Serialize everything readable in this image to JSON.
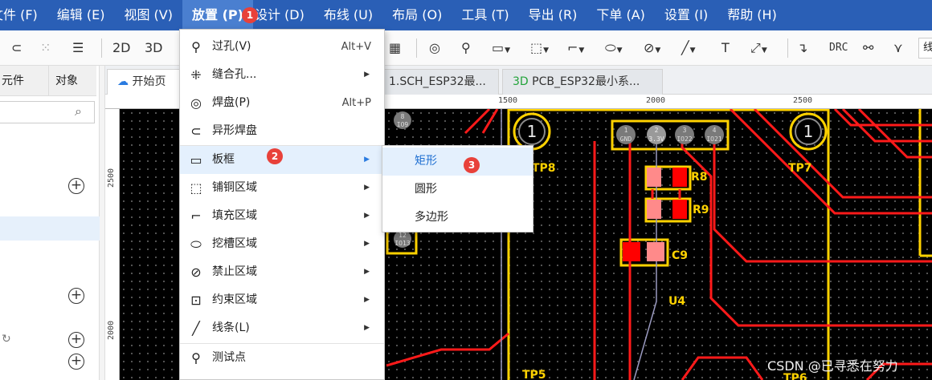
{
  "colors": {
    "menubar": "#2a5fb6",
    "menubar_active": "#4a7fd0",
    "badge": "#e8413a",
    "menu_hover": "#e4f0fd",
    "pcb_background": "#000000",
    "track_red": "#ff1a1a",
    "silkscreen_yellow": "#ffd200",
    "pad_pink": "#ff8a8a",
    "pad_red": "#ff0000"
  },
  "menubar": {
    "items": [
      "文件 (F)",
      "编辑 (E)",
      "视图 (V)",
      "放置 (P)",
      "设计 (D)",
      "布线 (U)",
      "布局 (O)",
      "工具 (T)",
      "导出 (R)",
      "下单 (A)",
      "设置 (I)",
      "帮助 (H)"
    ],
    "active_index": 3
  },
  "badges": {
    "b1": "1",
    "b2": "2",
    "b3": "3"
  },
  "toolbar": {
    "view_2d": "2D",
    "view_3d": "3D",
    "drc": "DRC",
    "search_text": "线",
    "icons": [
      "undo-icon",
      "select-grid-icon",
      "list-search-icon",
      "grid-icon",
      "via-icon",
      "stitch-icon",
      "board-frame-icon",
      "copper-area-icon",
      "fill-area-icon",
      "slot-icon",
      "keepout-icon",
      "line-icon",
      "text-icon",
      "dimension-icon",
      "route-icon",
      "diff-pair-icon",
      "length-tune-icon"
    ]
  },
  "left_panel": {
    "tab_components": "元件",
    "tab_objects": "对象"
  },
  "doc_tabs": {
    "home": "开始页",
    "sch": "1.SCH_ESP32最...",
    "pcb_prefix": "3D",
    "pcb": "PCB_ESP32最小系..."
  },
  "ruler": {
    "h": [
      "1500",
      "2000",
      "2500"
    ],
    "v": [
      "2500",
      "2000"
    ]
  },
  "place_menu": {
    "items": [
      {
        "label": "过孔(V)",
        "shortcut": "Alt+V",
        "submenu": false,
        "icon": "via-icon"
      },
      {
        "label": "缝合孔...",
        "shortcut": "",
        "submenu": true,
        "icon": "stitching-via-icon"
      },
      {
        "label": "焊盘(P)",
        "shortcut": "Alt+P",
        "submenu": false,
        "icon": "pad-icon"
      },
      {
        "label": "异形焊盘",
        "shortcut": "",
        "submenu": false,
        "icon": "custom-pad-icon"
      },
      {
        "label": "板框",
        "shortcut": "",
        "submenu": true,
        "icon": "board-frame-icon"
      },
      {
        "label": "铺铜区域",
        "shortcut": "",
        "submenu": true,
        "icon": "copper-pour-icon"
      },
      {
        "label": "填充区域",
        "shortcut": "",
        "submenu": true,
        "icon": "fill-region-icon"
      },
      {
        "label": "挖槽区域",
        "shortcut": "",
        "submenu": true,
        "icon": "slot-region-icon"
      },
      {
        "label": "禁止区域",
        "shortcut": "",
        "submenu": true,
        "icon": "keepout-region-icon"
      },
      {
        "label": "约束区域",
        "shortcut": "",
        "submenu": true,
        "icon": "constraint-region-icon"
      },
      {
        "label": "线条(L)",
        "shortcut": "",
        "submenu": true,
        "icon": "line-icon"
      },
      {
        "label": "测试点",
        "shortcut": "",
        "submenu": false,
        "icon": "test-point-icon"
      }
    ],
    "hover_index": 4
  },
  "submenu": {
    "items": [
      "矩形",
      "圆形",
      "多边形"
    ],
    "hover_index": 0
  },
  "pcb": {
    "components": [
      "TP8",
      "TP7",
      "TP5",
      "TP6",
      "R8",
      "R9",
      "C9",
      "U4"
    ],
    "header_pins": [
      "1",
      "2",
      "3",
      "4"
    ],
    "header_nets": [
      "GND",
      "3.3V",
      "IO22",
      "IO21"
    ],
    "testpoint_label": "1",
    "left_pad_labels": [
      "8",
      "IO9",
      "12",
      "IO13"
    ]
  },
  "watermark": "CSDN @已寻悉在努力"
}
